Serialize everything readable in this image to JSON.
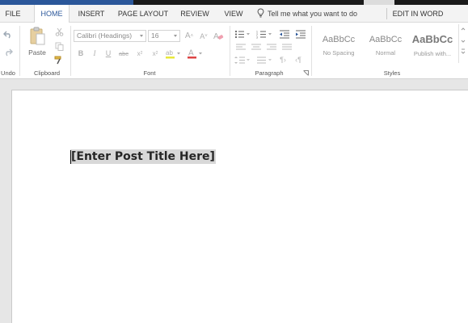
{
  "tabs": [
    {
      "label": "FILE"
    },
    {
      "label": "HOME"
    },
    {
      "label": "INSERT"
    },
    {
      "label": "PAGE LAYOUT"
    },
    {
      "label": "REVIEW"
    },
    {
      "label": "VIEW"
    }
  ],
  "tell_me": "Tell me what you want to do",
  "edit_in_word": "EDIT IN WORD",
  "ribbon": {
    "undo_label": "Undo",
    "clipboard": {
      "paste_label": "Paste",
      "group_label": "Clipboard"
    },
    "font": {
      "family": "Calibri (Headings)",
      "size": "16",
      "group_label": "Font"
    },
    "paragraph": {
      "group_label": "Paragraph"
    },
    "styles": {
      "group_label": "Styles",
      "items": [
        {
          "sample": "AaBbCc",
          "name": "No Spacing"
        },
        {
          "sample": "AaBbCc",
          "name": "Normal"
        },
        {
          "sample": "AaBbCc",
          "name": "Publish with..."
        }
      ]
    }
  },
  "document": {
    "title_placeholder": "[Enter Post Title Here]"
  },
  "colors": {
    "accent": "#2b579a",
    "highlight_yellow": "#e8e83a",
    "font_color_red": "#d44"
  }
}
